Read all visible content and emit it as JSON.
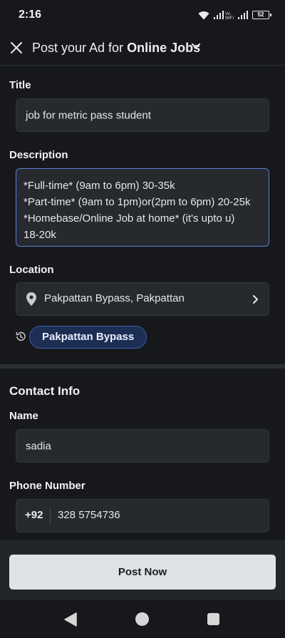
{
  "status_bar": {
    "time": "2:16",
    "battery": "52",
    "wifi_tag": "Vo\nWiFi"
  },
  "header": {
    "prefix": "Post your Ad for ",
    "category": "Online Jobs"
  },
  "form": {
    "title_label": "Title",
    "title_value": "job for metric pass student",
    "description_label": "Description",
    "description_lines": [
      "*Full-time* (9am to 6pm) 30-35k",
      "*Part-time* (9am to 1pm)or(2pm to 6pm) 20-25k",
      "*Homebase/Online Job at home* (it's upto u)",
      "18-20k"
    ],
    "location_label": "Location",
    "location_value": "Pakpattan Bypass, Pakpattan",
    "recent_location_chip": "Pakpattan Bypass"
  },
  "contact": {
    "section_title": "Contact Info",
    "name_label": "Name",
    "name_value": "sadia",
    "phone_label": "Phone Number",
    "phone_code": "+92",
    "phone_value": "328 5754736"
  },
  "footer": {
    "post_button": "Post Now"
  },
  "icons": {
    "close": "close-icon",
    "chevron": "chevron-down-icon",
    "location": "location-pin-icon",
    "arrow": "chevron-right-icon",
    "history": "history-icon"
  },
  "colors": {
    "background": "#16181c",
    "field": "#26292e",
    "accent_border": "#5a7fd8",
    "chip_bg": "#1d2e54",
    "button": "#dfe2e7"
  }
}
